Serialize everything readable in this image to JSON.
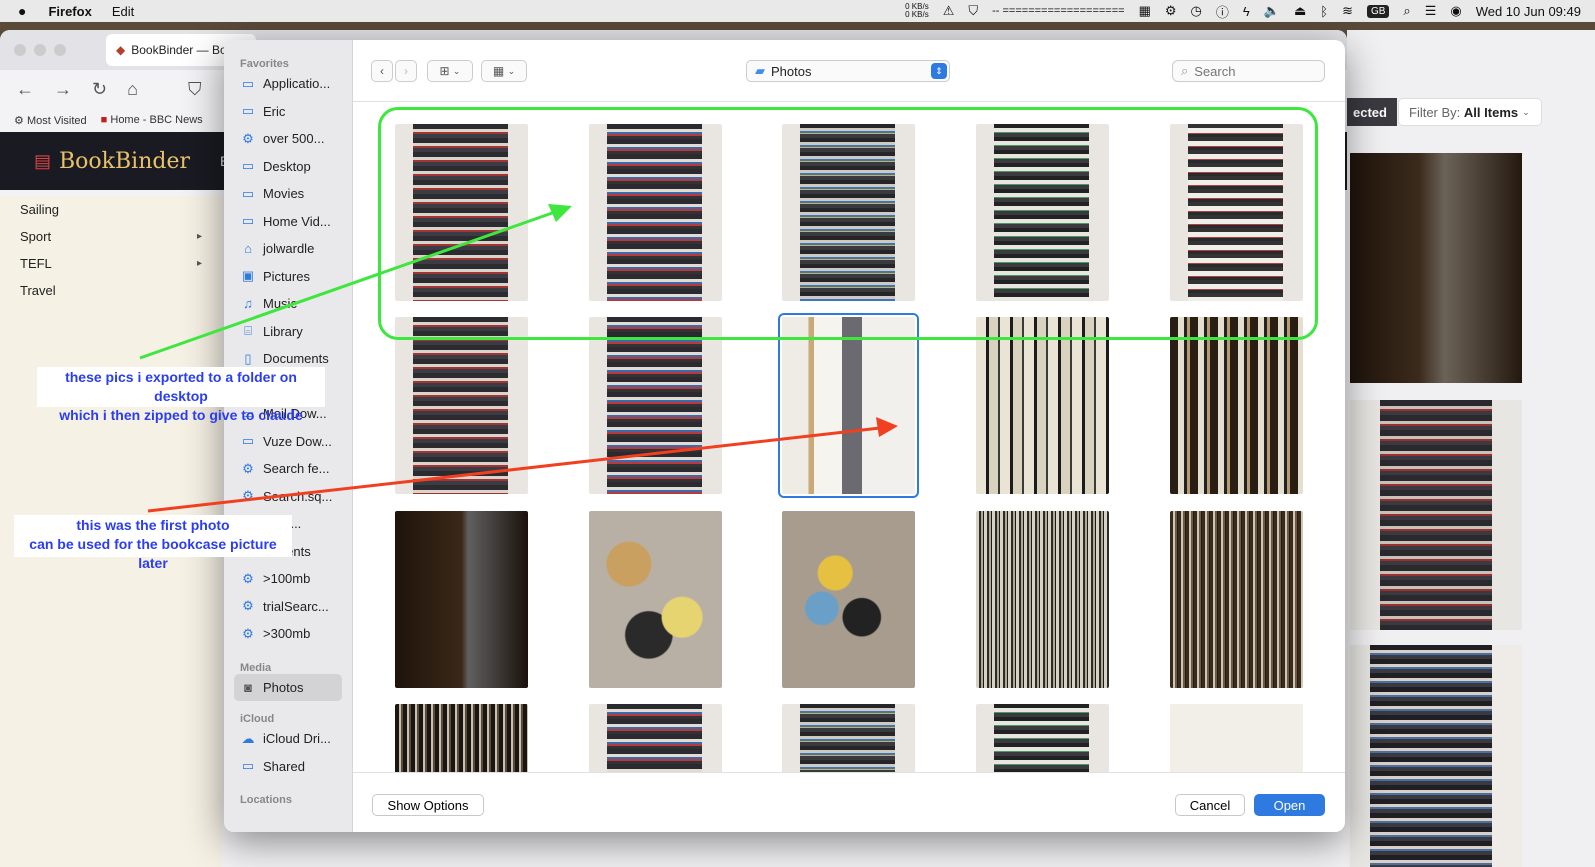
{
  "menubar": {
    "app": "Firefox",
    "edit": "Edit",
    "net_up": "0 KB/s",
    "net_down": "0 KB/s",
    "progress": "-- ===================",
    "keyboard": "GB",
    "clock": "Wed 10 Jun  09:49"
  },
  "browser": {
    "tab_title": "BookBinder — Bo",
    "bookmarks": [
      "Most Visited",
      "Home - BBC News"
    ],
    "site_title": "BookBinder",
    "site_nav_partial": "Br",
    "sidebar": [
      {
        "label": "Sailing",
        "arrow": ""
      },
      {
        "label": "Sport",
        "arrow": "▸"
      },
      {
        "label": "TEFL",
        "arrow": "▸"
      },
      {
        "label": "Travel",
        "arrow": ""
      }
    ],
    "filter_label": "Filter By:",
    "filter_value": "All Items",
    "selected_partial": "ected"
  },
  "dialog": {
    "sidebar_sections": {
      "favorites": "Favorites",
      "media": "Media",
      "icloud": "iCloud",
      "locations": "Locations"
    },
    "favorites": [
      {
        "label": "Applicatio...",
        "icon": "folder-icon"
      },
      {
        "label": "Eric",
        "icon": "folder-icon"
      },
      {
        "label": "over 500...",
        "icon": "gear-icon"
      },
      {
        "label": "Desktop",
        "icon": "folder-icon"
      },
      {
        "label": "Movies",
        "icon": "folder-icon"
      },
      {
        "label": "Home Vid...",
        "icon": "folder-icon"
      },
      {
        "label": "jolwardle",
        "icon": "home-icon"
      },
      {
        "label": "Pictures",
        "icon": "pictures-icon"
      },
      {
        "label": "Music",
        "icon": "music-icon"
      },
      {
        "label": "Library",
        "icon": "library-icon"
      },
      {
        "label": "Documents",
        "icon": "document-icon"
      },
      {
        "label": "s",
        "icon": "folder-icon"
      },
      {
        "label": "Mail Dow...",
        "icon": "folder-icon"
      },
      {
        "label": "Vuze Dow...",
        "icon": "folder-icon"
      },
      {
        "label": "Search fe...",
        "icon": "gear-icon"
      },
      {
        "label": "Search.sq...",
        "icon": "gear-icon"
      },
      {
        "label": "catio...",
        "icon": "gear-icon"
      },
      {
        "label": "Recents",
        "icon": "clock-icon"
      },
      {
        "label": ">100mb",
        "icon": "gear-icon"
      },
      {
        "label": "trialSearc...",
        "icon": "gear-icon"
      },
      {
        "label": ">300mb",
        "icon": "gear-icon"
      }
    ],
    "media": [
      {
        "label": "Photos",
        "icon": "camera-icon"
      }
    ],
    "icloud": [
      {
        "label": "iCloud Dri...",
        "icon": "cloud-icon"
      },
      {
        "label": "Shared",
        "icon": "shared-folder-icon"
      }
    ],
    "location": "Photos",
    "search_placeholder": "Search",
    "show_options": "Show Options",
    "cancel": "Cancel",
    "open": "Open",
    "selected_photo_index": 7,
    "colors": {
      "accent": "#2f7ae0",
      "green_annotation": "#3ee63e",
      "red_annotation": "#f04020",
      "note_text": "#2a3df0"
    }
  },
  "annotations": {
    "green_note_line1": "these pics i exported to a folder on desktop",
    "green_note_line2": "which i then zipped to give to claude",
    "red_note_line1": "this was the first photo",
    "red_note_line2": "can be used for the bookcase picture later"
  }
}
